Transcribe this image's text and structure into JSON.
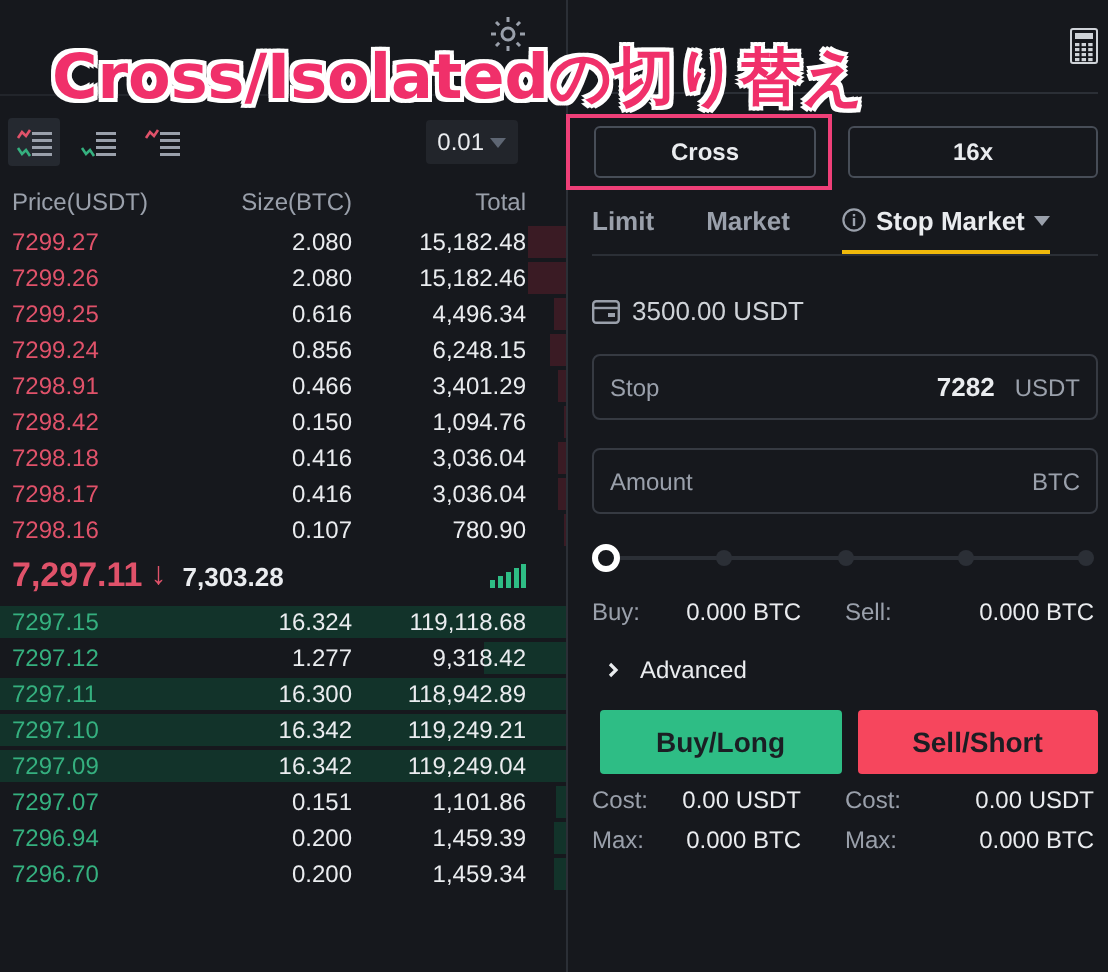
{
  "overlay": {
    "caption": "Cross/Isolatedの切り替え"
  },
  "orderbook": {
    "view_modes": [
      {
        "kind": "both",
        "selected": true
      },
      {
        "kind": "bids",
        "selected": false
      },
      {
        "kind": "asks",
        "selected": false
      }
    ],
    "precision": "0.01",
    "columns": [
      "Price(USDT)",
      "Size(BTC)",
      "Total"
    ],
    "asks": [
      {
        "price": "7299.27",
        "size": "2.080",
        "total": "15,182.48"
      },
      {
        "price": "7299.26",
        "size": "2.080",
        "total": "15,182.46"
      },
      {
        "price": "7299.25",
        "size": "0.616",
        "total": "4,496.34"
      },
      {
        "price": "7299.24",
        "size": "0.856",
        "total": "6,248.15"
      },
      {
        "price": "7298.91",
        "size": "0.466",
        "total": "3,401.29"
      },
      {
        "price": "7298.42",
        "size": "0.150",
        "total": "1,094.76"
      },
      {
        "price": "7298.18",
        "size": "0.416",
        "total": "3,036.04"
      },
      {
        "price": "7298.17",
        "size": "0.416",
        "total": "3,036.04"
      },
      {
        "price": "7298.16",
        "size": "0.107",
        "total": "780.90"
      }
    ],
    "last_price": {
      "price": "7,297.11",
      "rising": false,
      "arrow": "↓",
      "mark_price": "7,303.28"
    },
    "bids": [
      {
        "price": "7297.15",
        "size": "16.324",
        "total": "119,118.68"
      },
      {
        "price": "7297.12",
        "size": "1.277",
        "total": "9,318.42"
      },
      {
        "price": "7297.11",
        "size": "16.300",
        "total": "118,942.89"
      },
      {
        "price": "7297.10",
        "size": "16.342",
        "total": "119,249.21"
      },
      {
        "price": "7297.09",
        "size": "16.342",
        "total": "119,249.04"
      },
      {
        "price": "7297.07",
        "size": "0.151",
        "total": "1,101.86"
      },
      {
        "price": "7296.94",
        "size": "0.200",
        "total": "1,459.39"
      },
      {
        "price": "7296.70",
        "size": "0.200",
        "total": "1,459.34"
      }
    ]
  },
  "order_form": {
    "margin_buttons": [
      {
        "label": "Cross",
        "highlighted": true
      },
      {
        "label": "16x",
        "highlighted": false
      }
    ],
    "tabs": [
      {
        "label": "Limit",
        "selected": false
      },
      {
        "label": "Market",
        "selected": false
      },
      {
        "label": "Stop Market",
        "selected": true
      }
    ],
    "balance": "3500.00 USDT",
    "stop_field": {
      "label": "Stop",
      "value": "7282",
      "unit": "USDT"
    },
    "amount_field": {
      "placeholder": "Amount",
      "unit": "BTC"
    },
    "slider": {
      "level": 0
    },
    "estimates": [
      {
        "label": "Buy:",
        "value": "0.000 BTC"
      },
      {
        "label": "Sell:",
        "value": "0.000 BTC"
      }
    ],
    "advanced": {
      "label": "Advanced",
      "expanded": false
    },
    "actions": [
      {
        "label": "Buy/Long",
        "kind": "buy"
      },
      {
        "label": "Sell/Short",
        "kind": "sell"
      }
    ],
    "summary_rows": [
      [
        {
          "label": "Cost:",
          "value": "0.00 USDT"
        },
        {
          "label": "Cost:",
          "value": "0.00 USDT"
        }
      ],
      [
        {
          "label": "Max:",
          "value": "0.000 BTC"
        },
        {
          "label": "Max:",
          "value": "0.000 BTC"
        }
      ]
    ]
  }
}
